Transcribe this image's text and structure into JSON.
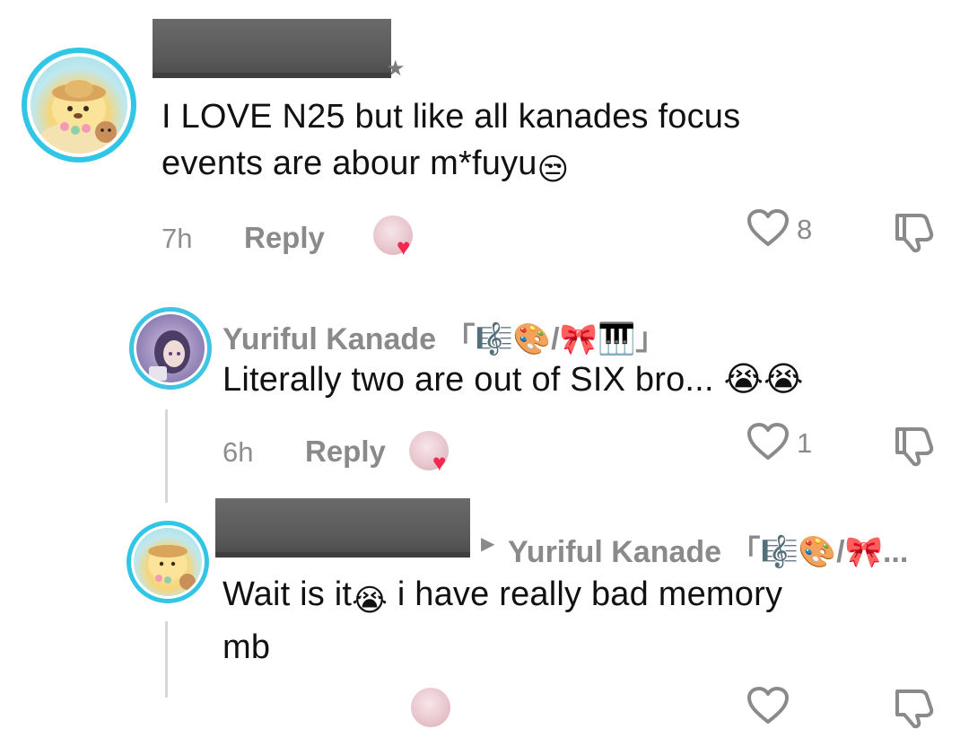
{
  "comments": [
    {
      "username_redacted": true,
      "text_line1": "I LOVE N25 but like all kanades focus",
      "text_line2": "events are abour m*fuyu",
      "emoji2": "😒",
      "time": "7h",
      "reply_label": "Reply",
      "likes": "8"
    },
    {
      "username": "Yuriful Kanade 「🎼🎨/🎀🎹」",
      "text": "Literally two are out of SIX bro... 😭😭",
      "time": "6h",
      "reply_label": "Reply",
      "likes": "1"
    },
    {
      "username_redacted": true,
      "reply_to": "Yuriful Kanade 「🎼🎨/🎀...",
      "text_line1a": "Wait is it",
      "emoji1": "😭",
      "text_line1b": " i have really bad memory",
      "text_line2": "mb"
    }
  ],
  "colors": {
    "avatar_ring": "#32c6e6",
    "like_heart": "#f4284f",
    "muted_text": "#8a8a8a"
  },
  "icons": [
    "heart-outline-icon",
    "thumb-down-icon",
    "creator-liked-heart-icon",
    "play-triangle-icon"
  ]
}
